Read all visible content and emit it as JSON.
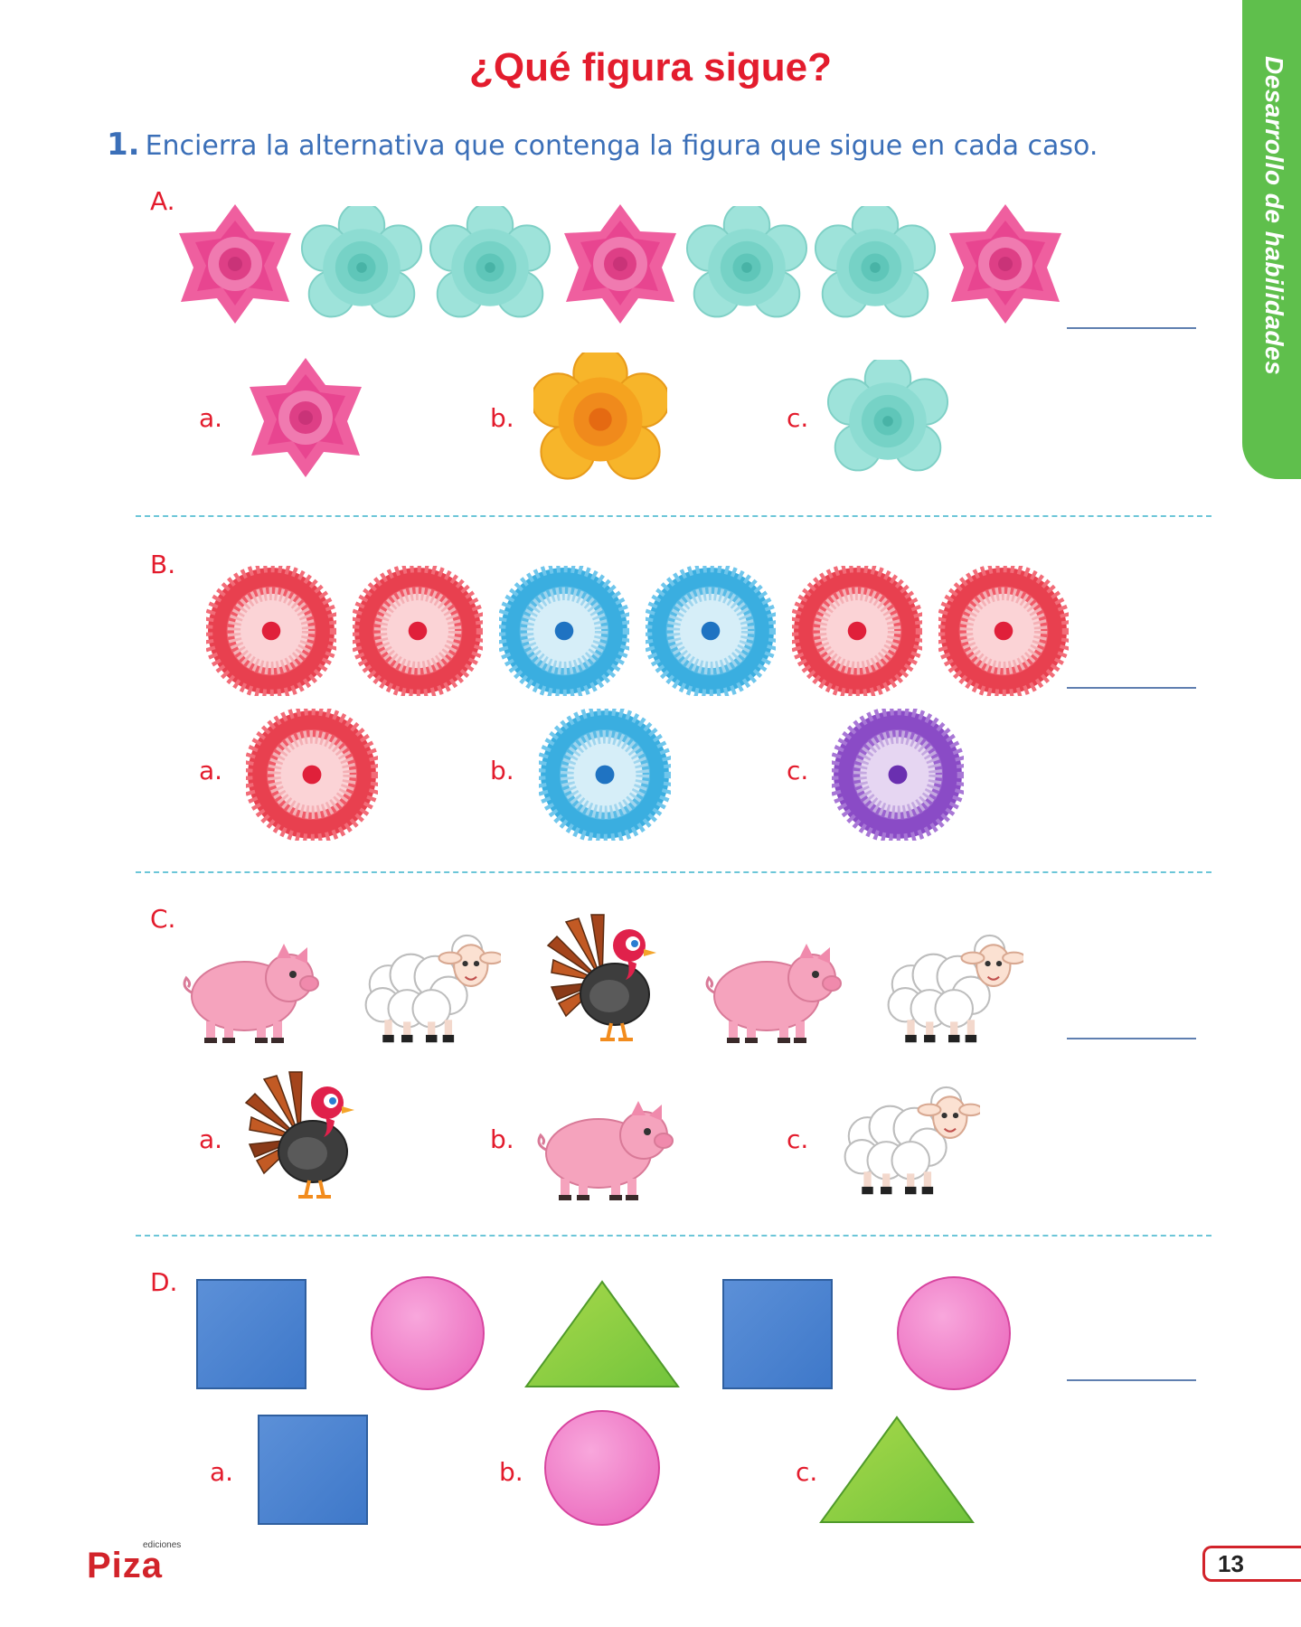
{
  "title": "¿Qué figura sigue?",
  "side_tab": "Desarrollo de habilidades",
  "instruction": {
    "number": "1.",
    "text": "Encierra la alternativa que contenga la figura que sigue en cada caso."
  },
  "sections": {
    "A": {
      "label": "A.",
      "sequence": [
        "pink-rose",
        "teal-rose",
        "teal-rose",
        "pink-rose",
        "teal-rose",
        "teal-rose",
        "pink-rose"
      ],
      "options": {
        "a": "a.",
        "b": "b.",
        "c": "c."
      },
      "option_figures": [
        "pink-rose",
        "orange-rose",
        "teal-rose"
      ]
    },
    "B": {
      "label": "B.",
      "sequence": [
        "red-fan",
        "red-fan",
        "blue-fan",
        "blue-fan",
        "red-fan",
        "red-fan"
      ],
      "options": {
        "a": "a.",
        "b": "b.",
        "c": "c."
      },
      "option_figures": [
        "red-fan",
        "blue-fan",
        "purple-fan"
      ]
    },
    "C": {
      "label": "C.",
      "sequence": [
        "pig",
        "sheep",
        "turkey",
        "pig",
        "sheep"
      ],
      "options": {
        "a": "a.",
        "b": "b.",
        "c": "c."
      },
      "option_figures": [
        "turkey",
        "pig",
        "sheep"
      ]
    },
    "D": {
      "label": "D.",
      "sequence": [
        "blue-square",
        "pink-circle",
        "green-triangle",
        "blue-square",
        "pink-circle"
      ],
      "options": {
        "a": "a.",
        "b": "b.",
        "c": "c."
      },
      "option_figures": [
        "blue-square",
        "pink-circle",
        "green-triangle"
      ]
    }
  },
  "logo": {
    "small": "ediciones",
    "name": "Piza"
  },
  "page_number": "13",
  "colors": {
    "title": "#e31c2d",
    "instruction": "#3b6fb8",
    "tab": "#5fbf4c",
    "divider": "#6cc6d8"
  }
}
